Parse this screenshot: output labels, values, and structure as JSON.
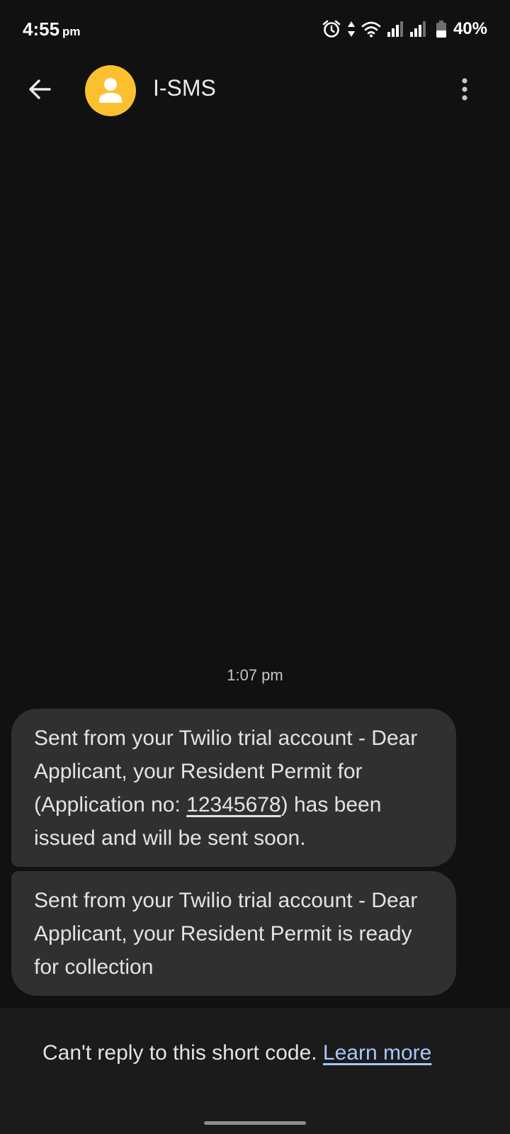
{
  "status_bar": {
    "time": "4:55",
    "ampm": "pm",
    "battery_percent": "40%",
    "icons": [
      "alarm-icon",
      "data-arrows-icon",
      "wifi-icon",
      "signal-icon",
      "signal-icon",
      "battery-icon"
    ]
  },
  "app_bar": {
    "back_icon": "arrow-back-icon",
    "avatar_icon": "person-icon",
    "avatar_color": "#fbc02d",
    "contact_name": "I-SMS",
    "menu_icon": "more-vert-icon"
  },
  "conversation": {
    "timestamp": "1:07 pm",
    "messages": [
      {
        "text_before": "Sent from your Twilio trial account - Dear Applicant, your Resident Permit for (Application no: ",
        "application_no": "12345678",
        "text_after": ") has been issued and will be sent soon."
      },
      {
        "text": "Sent from your Twilio trial account - Dear Applicant, your Resident Permit is ready for collection"
      }
    ]
  },
  "footer": {
    "notice": "Can't reply to this short code. ",
    "learn_more": "Learn more"
  },
  "colors": {
    "background": "#111111",
    "bubble": "#303030",
    "link": "#a8c7fa"
  }
}
